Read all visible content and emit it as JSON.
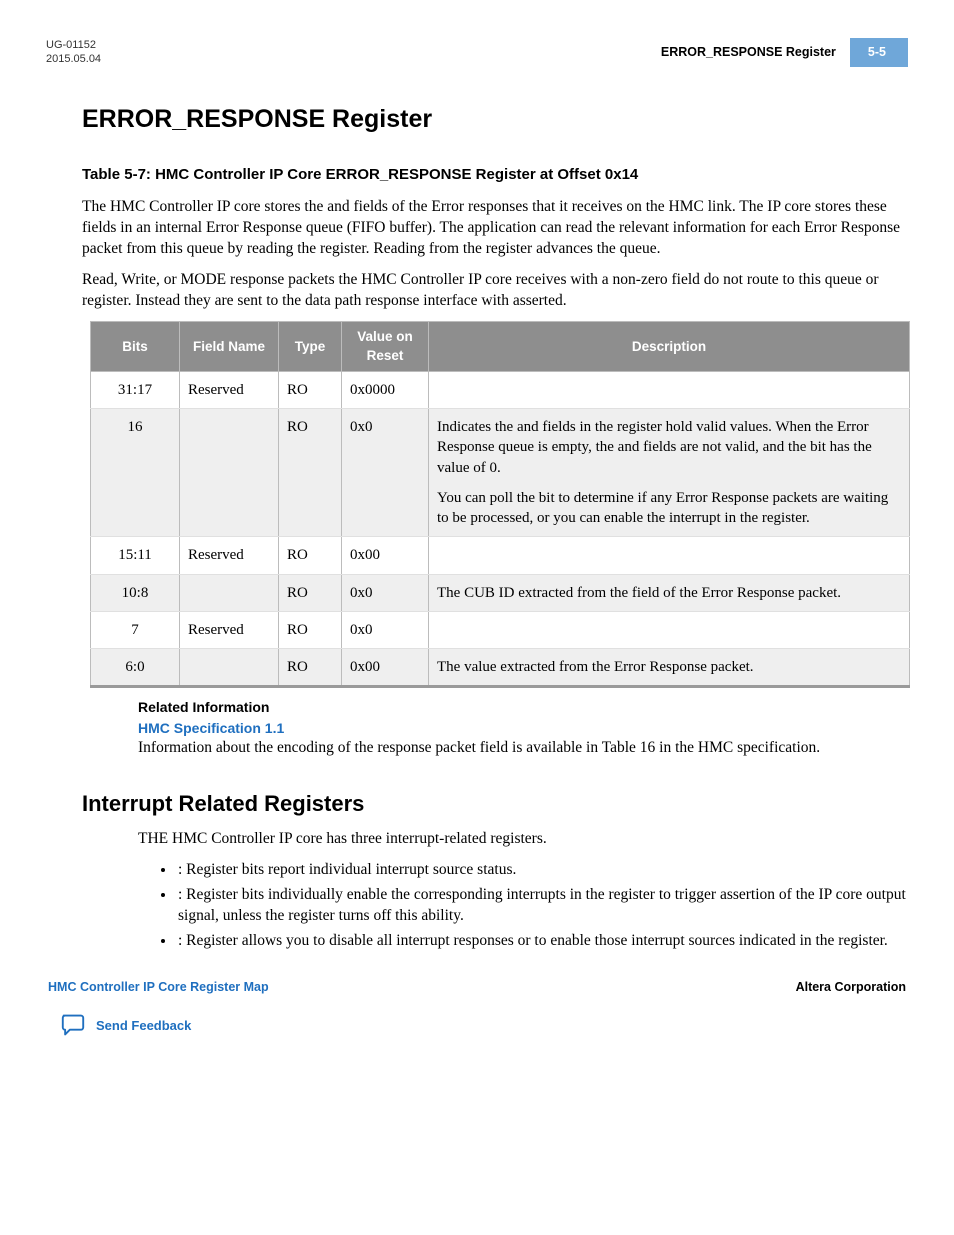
{
  "header": {
    "doc_id": "UG-01152",
    "date": "2015.05.04",
    "running_title": "ERROR_RESPONSE Register",
    "page_no": "5-5"
  },
  "section1": {
    "title": "ERROR_RESPONSE Register",
    "table_caption": "Table 5-7: HMC Controller IP Core ERROR_RESPONSE Register at Offset 0x14",
    "para1": "The HMC Controller IP core stores the               and         fields of the Error responses that it receives on the HMC link. The IP core stores these fields in an internal Error Response queue (FIFO buffer). The application can read the relevant information for each Error Response packet from this queue by reading the                          register. Reading from the register advances the queue.",
    "para2": "Read, Write, or MODE response packets the HMC Controller IP core receives with a non-zero             field do not route to this queue or register. Instead they are sent to the data path response interface with                   asserted."
  },
  "table": {
    "headers": [
      "Bits",
      "Field Name",
      "Type",
      "Value on Reset",
      "Description"
    ],
    "rows": [
      {
        "bits": "31:17",
        "fname": "Reserved",
        "type": "RO",
        "reset": "0x0000",
        "desc": [
          ""
        ]
      },
      {
        "bits": "16",
        "fname": "",
        "type": "RO",
        "reset": "0x0",
        "desc": [
          "Indicates the             and               fields in the register hold valid values. When the Error Response queue is empty, the             and               fields are not valid, and the             bit has the value of 0.",
          "You can poll the             bit to determine if any Error Response packets are waiting to be processed, or you can enable the                                     interrupt in the                                   register."
        ]
      },
      {
        "bits": "15:11",
        "fname": "Reserved",
        "type": "RO",
        "reset": "0x00",
        "desc": [
          ""
        ]
      },
      {
        "bits": "10:8",
        "fname": "",
        "type": "RO",
        "reset": "0x0",
        "desc": [
          "The CUB ID extracted from the             field of the Error Response packet."
        ]
      },
      {
        "bits": "7",
        "fname": "Reserved",
        "type": "RO",
        "reset": "0x0",
        "desc": [
          ""
        ]
      },
      {
        "bits": "6:0",
        "fname": "",
        "type": "RO",
        "reset": "0x00",
        "desc": [
          "The                value extracted from the Error Response packet."
        ]
      }
    ]
  },
  "related": {
    "head": "Related Information",
    "link": "HMC Specification 1.1",
    "text": "Information about the encoding of the                  response packet field is available in Table 16 in the HMC specification."
  },
  "section2": {
    "title": "Interrupt Related Registers",
    "intro": "THE HMC Controller IP core has three interrupt-related registers.",
    "items": [
      "                                 : Register bits report individual interrupt source status.",
      "                                 : Register bits individually enable the corresponding interrupts in the                                   register to trigger assertion of the IP core                  output signal, unless the                                         register turns off this ability.",
      "                                         : Register allows you to disable all interrupt responses or to enable those interrupt sources indicated in the                                   register."
    ]
  },
  "footer": {
    "left": "HMC Controller IP Core Register Map",
    "right": "Altera Corporation",
    "feedback": "Send Feedback"
  }
}
